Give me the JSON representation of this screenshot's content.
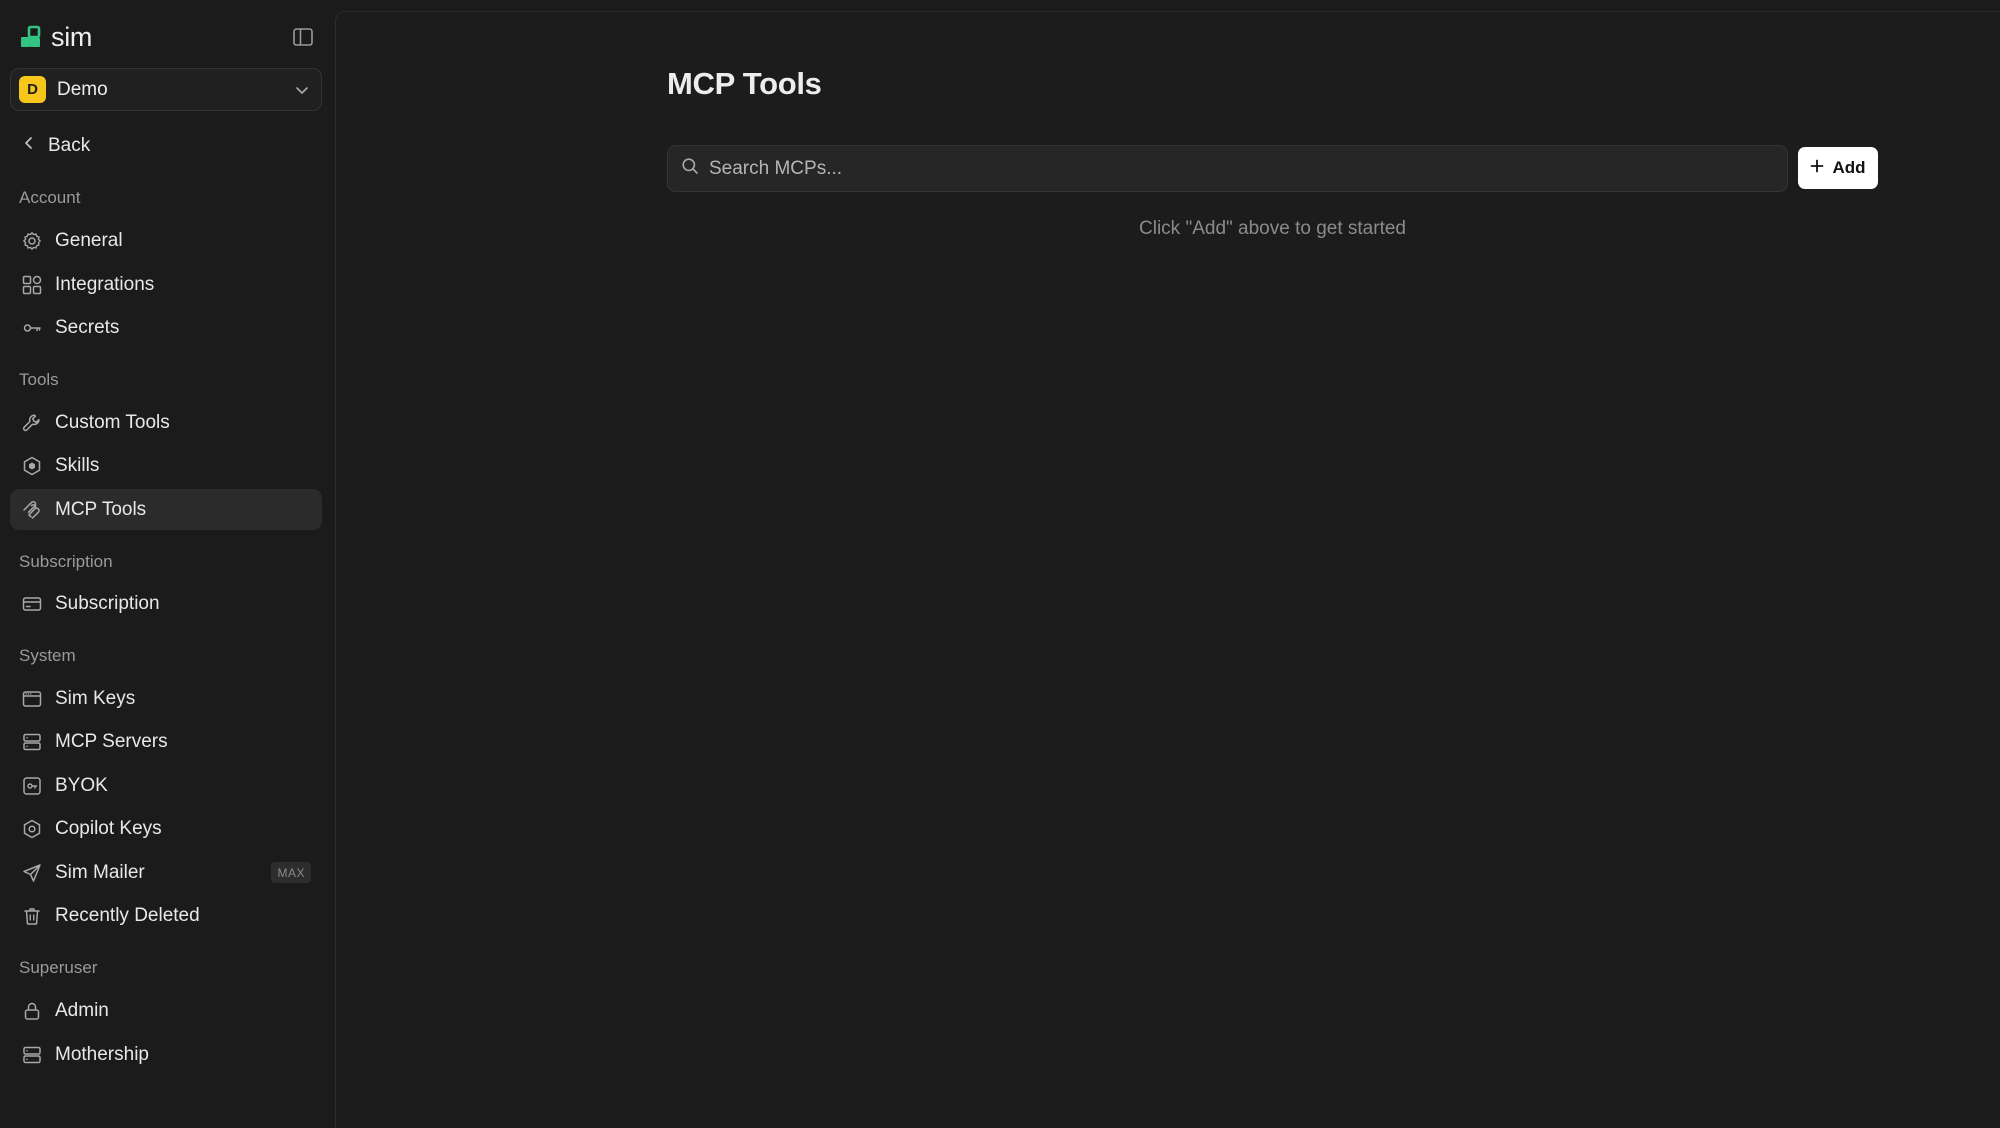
{
  "brand": {
    "name": "sim"
  },
  "workspace": {
    "initial": "D",
    "name": "Demo"
  },
  "back_label": "Back",
  "sections": {
    "account": "Account",
    "tools": "Tools",
    "subscription": "Subscription",
    "system": "System",
    "superuser": "Superuser"
  },
  "nav": {
    "general": "General",
    "integrations": "Integrations",
    "secrets": "Secrets",
    "custom_tools": "Custom Tools",
    "skills": "Skills",
    "mcp_tools": "MCP Tools",
    "subscription": "Subscription",
    "sim_keys": "Sim Keys",
    "mcp_servers": "MCP Servers",
    "byok": "BYOK",
    "copilot_keys": "Copilot Keys",
    "sim_mailer": "Sim Mailer",
    "sim_mailer_badge": "MAX",
    "recently_deleted": "Recently Deleted",
    "admin": "Admin",
    "mothership": "Mothership"
  },
  "active_item": "MCP Tools",
  "main": {
    "title": "MCP Tools",
    "search_placeholder": "Search MCPs...",
    "search_value": "",
    "add_label": "Add",
    "empty_message": "Click \"Add\" above to get started"
  },
  "colors": {
    "background": "#1b1b1b",
    "accent_green": "#33c482",
    "workspace_avatar": "#f7c61b",
    "active_item_bg": "#2b2b2b"
  }
}
